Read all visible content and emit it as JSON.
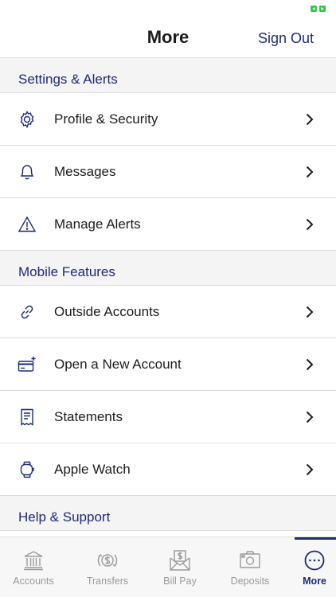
{
  "header": {
    "title": "More",
    "sign_out_label": "Sign Out"
  },
  "sections": [
    {
      "title": "Settings & Alerts",
      "items": [
        {
          "label": "Profile & Security",
          "icon": "gear-icon"
        },
        {
          "label": "Messages",
          "icon": "bell-icon"
        },
        {
          "label": "Manage Alerts",
          "icon": "warning-icon"
        }
      ]
    },
    {
      "title": "Mobile Features",
      "items": [
        {
          "label": "Outside Accounts",
          "icon": "link-icon"
        },
        {
          "label": "Open a New Account",
          "icon": "new-card-icon"
        },
        {
          "label": "Statements",
          "icon": "statement-icon"
        },
        {
          "label": "Apple Watch",
          "icon": "watch-icon"
        }
      ]
    },
    {
      "title": "Help & Support",
      "items": []
    }
  ],
  "tabbar": {
    "items": [
      {
        "label": "Accounts",
        "icon": "bank-icon",
        "active": false
      },
      {
        "label": "Transfers",
        "icon": "transfer-icon",
        "active": false
      },
      {
        "label": "Bill Pay",
        "icon": "bill-pay-icon",
        "active": false
      },
      {
        "label": "Deposits",
        "icon": "camera-icon",
        "active": false
      },
      {
        "label": "More",
        "icon": "more-icon",
        "active": true
      }
    ]
  },
  "colors": {
    "accent": "#1e2a78",
    "battery": "#2ecc40",
    "section_bg": "#f4f4f4",
    "inactive_tab": "#9a9a9a"
  }
}
